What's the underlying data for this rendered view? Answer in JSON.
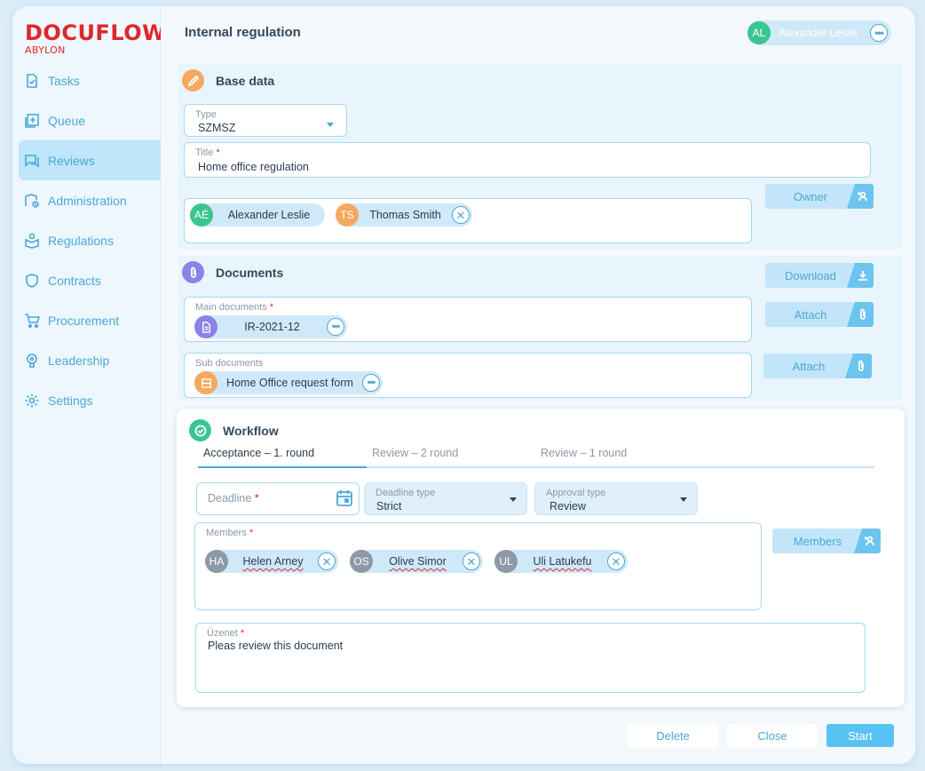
{
  "app": {
    "logo": "DOCUFLOW",
    "logo_sub": "ABYLON"
  },
  "sidebar": {
    "items": [
      {
        "label": "Tasks",
        "icon": "task-check-icon"
      },
      {
        "label": "Queue",
        "icon": "queue-plus-icon"
      },
      {
        "label": "Reviews",
        "icon": "reviews-chat-icon",
        "active": true
      },
      {
        "label": "Administration",
        "icon": "administration-icon"
      },
      {
        "label": "Regulations",
        "icon": "regulations-icon"
      },
      {
        "label": "Contracts",
        "icon": "shield-icon"
      },
      {
        "label": "Procurement",
        "icon": "cart-icon"
      },
      {
        "label": "Leadership",
        "icon": "leadership-icon"
      },
      {
        "label": "Settings",
        "icon": "gear-icon"
      }
    ]
  },
  "header": {
    "title": "Internal regulation",
    "user": {
      "initials": "AL",
      "name": "Alexander Leslie",
      "menu": "•••"
    }
  },
  "base_data": {
    "title": "Base data",
    "type": {
      "label": "Type",
      "value": "SZMSZ"
    },
    "doc_title": {
      "label": "Title",
      "required": "*",
      "value": "Home office regulation"
    },
    "owners": [
      {
        "initials": "AÉ",
        "name": "Alexander Leslie"
      },
      {
        "initials": "TS",
        "name": "Thomas Smith",
        "remove": "✕"
      }
    ],
    "owner_button": "Owner"
  },
  "documents": {
    "title": "Documents",
    "download_button": "Download",
    "main": {
      "label": "Main documents",
      "required": "*",
      "item": "IR-2021-12",
      "menu": "•••"
    },
    "sub": {
      "label": "Sub documents",
      "item": "Home Office request form",
      "menu": "•••"
    },
    "attach_button": "Attach"
  },
  "workflow": {
    "title": "Workflow",
    "tabs": [
      "Acceptance – 1. round",
      "Review – 2 round",
      "Review – 1 round"
    ],
    "deadline": {
      "placeholder": "Deadline",
      "required": "*"
    },
    "deadline_type": {
      "label": "Deadline type",
      "value": "Strict"
    },
    "approval_type": {
      "label": "Approval type",
      "value": "Review"
    },
    "members": {
      "label": "Members",
      "required": "*",
      "items": [
        {
          "initials": "HA",
          "name": "Helen Arney",
          "remove": "✕"
        },
        {
          "initials": "OS",
          "name": "Olive Simor",
          "remove": "✕"
        },
        {
          "initials": "UL",
          "name": "Uli Latukefu",
          "remove": "✕"
        }
      ]
    },
    "members_button": "Members",
    "message": {
      "label": "Üzenet",
      "required": "*",
      "value": "Pleas review this document"
    }
  },
  "footer": {
    "delete": "Delete",
    "close": "Close",
    "start": "Start"
  },
  "colors": {
    "accent": "#4aa8d8",
    "brand": "#e0262b",
    "primary_button": "#58c3f2"
  }
}
